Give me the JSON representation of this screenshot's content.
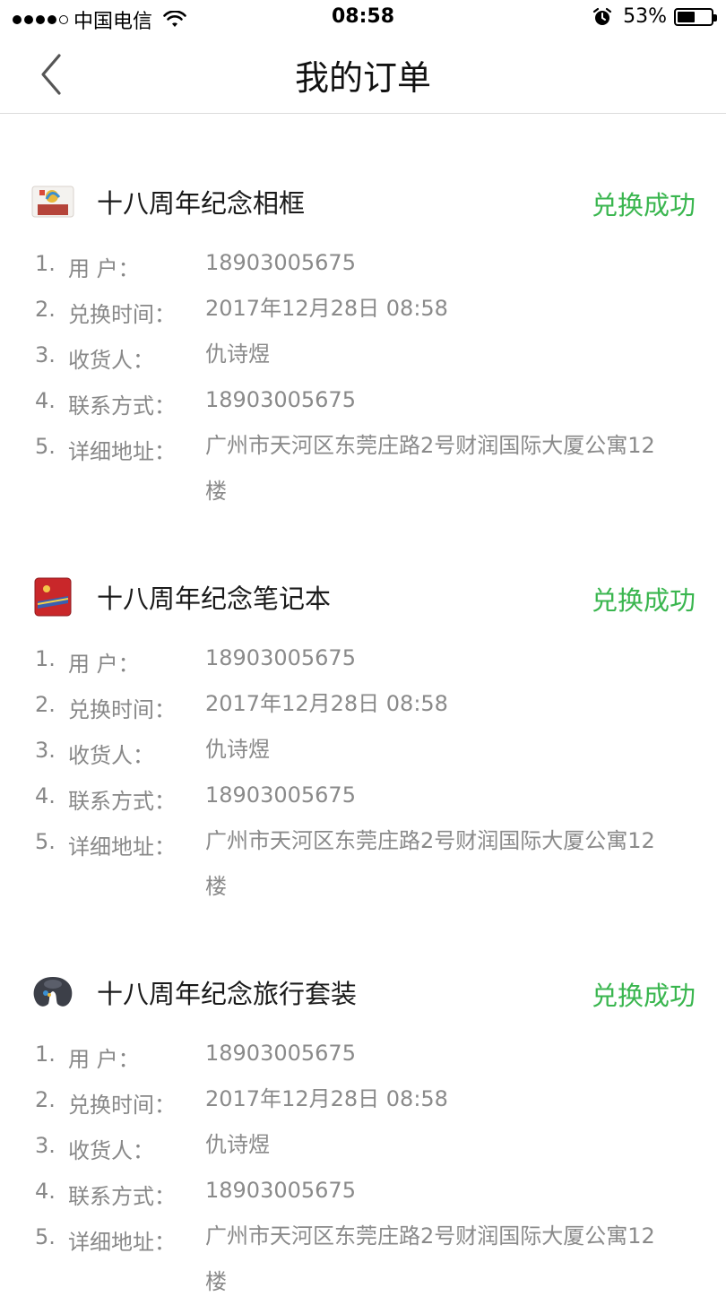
{
  "status_bar": {
    "carrier": "中国电信",
    "time": "08:58",
    "battery_percent": "53%",
    "battery_level": 0.53
  },
  "nav": {
    "back_icon": "chevron-left-icon",
    "title": "我的订单"
  },
  "field_labels": {
    "user": "用  户：",
    "exchange_time": "兑换时间：",
    "receiver": "收货人：",
    "contact": "联系方式：",
    "address": "详细地址："
  },
  "row_numbers": [
    "1.",
    "2.",
    "3.",
    "4.",
    "5."
  ],
  "orders": [
    {
      "product": "十八周年纪念相框",
      "status": "兑换成功",
      "thumb_icon": "photo-frame-thumbnail",
      "user": "18903005675",
      "exchange_time": "2017年12月28日 08:58",
      "receiver": "仇诗煜",
      "contact": "18903005675",
      "address_line1": "广州市天河区东莞庄路2号财润国际大厦公寓12",
      "address_line2": "楼"
    },
    {
      "product": "十八周年纪念笔记本",
      "status": "兑换成功",
      "thumb_icon": "notebook-thumbnail",
      "user": "18903005675",
      "exchange_time": "2017年12月28日 08:58",
      "receiver": "仇诗煜",
      "contact": "18903005675",
      "address_line1": "广州市天河区东莞庄路2号财润国际大厦公寓12",
      "address_line2": "楼"
    },
    {
      "product": "十八周年纪念旅行套装",
      "status": "兑换成功",
      "thumb_icon": "travel-pillow-thumbnail",
      "user": "18903005675",
      "exchange_time": "2017年12月28日 08:58",
      "receiver": "仇诗煜",
      "contact": "18903005675",
      "address_line1": "广州市天河区东莞庄路2号财润国际大厦公寓12",
      "address_line2": "楼"
    }
  ],
  "colors": {
    "status_green": "#3ab64f",
    "muted_text": "#888888"
  }
}
